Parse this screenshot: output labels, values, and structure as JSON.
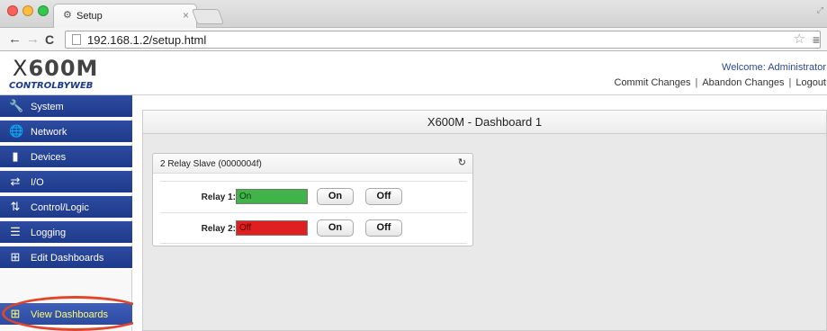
{
  "browser": {
    "tab_title": "Setup",
    "tab_icon": "⚙",
    "tab_close": "×",
    "url": "192.168.1.2/setup.html",
    "icons": [
      "back-arrow-icon",
      "forward-arrow-icon",
      "reload-icon",
      "page-icon",
      "star-icon",
      "menu-icon"
    ]
  },
  "header": {
    "logo_text": "600M",
    "logo_x": "X",
    "logo_sub": "CONTROLBYWEB",
    "welcome": "Welcome: Administrator",
    "links": {
      "commit": "Commit Changes",
      "separator": "|",
      "abandon": "Abandon Changes",
      "logout": "Logout"
    }
  },
  "sidebar": {
    "items": [
      {
        "label": "System",
        "icon": "wrench-icon",
        "glyph": "🔧"
      },
      {
        "label": "Network",
        "icon": "globe-icon",
        "glyph": "🌐"
      },
      {
        "label": "Devices",
        "icon": "device-icon",
        "glyph": "▮"
      },
      {
        "label": "I/O",
        "icon": "swap-arrows-icon",
        "glyph": "⇄"
      },
      {
        "label": "Control/Logic",
        "icon": "control-logic-icon",
        "glyph": "⇅"
      },
      {
        "label": "Logging",
        "icon": "list-icon",
        "glyph": "☰"
      },
      {
        "label": "Edit Dashboards",
        "icon": "dashboard-edit-icon",
        "glyph": "⊞"
      },
      {
        "label": "View Dashboards",
        "icon": "dashboard-view-icon",
        "glyph": "⊞",
        "active": true
      }
    ],
    "highlight_color": "#e0462a",
    "active_label_color": "#ffff66",
    "nav_color": "#1e3a8a"
  },
  "main": {
    "dashboard_title": "X600M - Dashboard 1",
    "widget": {
      "title": "2 Relay Slave (0000004f)",
      "refresh_icon": "refresh-icon",
      "refresh_glyph": "↻",
      "relays": [
        {
          "label": "Relay 1:",
          "state": "On",
          "state_color": "#41b449",
          "on_label": "On",
          "off_label": "Off"
        },
        {
          "label": "Relay 2:",
          "state": "Off",
          "state_color": "#e02020",
          "on_label": "On",
          "off_label": "Off"
        }
      ]
    }
  }
}
